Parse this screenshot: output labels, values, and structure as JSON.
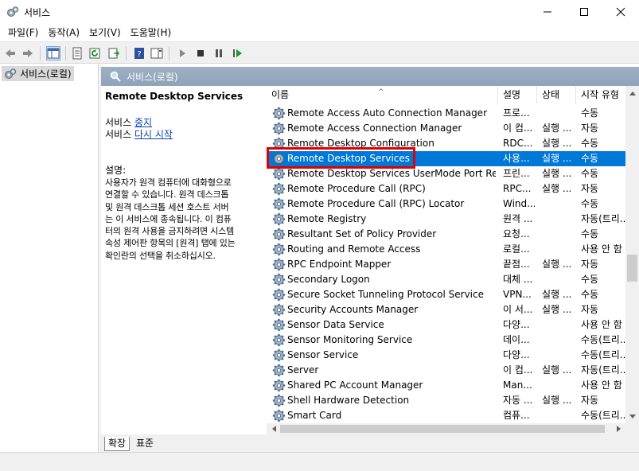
{
  "window": {
    "title": "서비스"
  },
  "menu": [
    "파일(F)",
    "동작(A)",
    "보기(V)",
    "도움말(H)"
  ],
  "tree": {
    "root_label": "서비스(로컬)"
  },
  "panel": {
    "header_label": "서비스(로컬)"
  },
  "detail": {
    "service_name": "Remote Desktop Services",
    "stop_prefix": "서비스 ",
    "stop_link": "중지",
    "restart_prefix": "서비스 ",
    "restart_link": "다시 시작",
    "desc_label": "설명:",
    "desc_lines": [
      "사용자가 원격 컴퓨터에 대화형으로",
      "연결할 수 있습니다. 원격 데스크톱",
      "및 원격 데스크톱 세션 호스트 서버",
      "는 이 서비스에 종속됩니다. 이 컴퓨",
      "터의 원격 사용을 금지하려면 시스템",
      "속성 제어판 항목의 [원격] 탭에 있는",
      "확인란의 선택을 취소하십시오."
    ]
  },
  "columns": {
    "name": "이름",
    "description": "설명",
    "status": "상태",
    "startup": "시작 유형"
  },
  "rows": [
    {
      "name": "Remote Access Auto Connection Manager",
      "desc": "프로...",
      "status": "",
      "startup": "수동"
    },
    {
      "name": "Remote Access Connection Manager",
      "desc": "이 컴...",
      "status": "실행 ...",
      "startup": "자동"
    },
    {
      "name": "Remote Desktop Configuration",
      "desc": "RDC...",
      "status": "실행 ...",
      "startup": "수동"
    },
    {
      "name": "Remote Desktop Services",
      "desc": "사용...",
      "status": "실행 ...",
      "startup": "수동"
    },
    {
      "name": "Remote Desktop Services UserMode Port Redir...",
      "desc": "프린...",
      "status": "실행 ...",
      "startup": "수동"
    },
    {
      "name": "Remote Procedure Call (RPC)",
      "desc": "RPC...",
      "status": "실행 ...",
      "startup": "자동"
    },
    {
      "name": "Remote Procedure Call (RPC) Locator",
      "desc": "Wind...",
      "status": "",
      "startup": "수동"
    },
    {
      "name": "Remote Registry",
      "desc": "원격 ...",
      "status": "",
      "startup": "자동(트리..."
    },
    {
      "name": "Resultant Set of Policy Provider",
      "desc": "요청...",
      "status": "",
      "startup": "수동"
    },
    {
      "name": "Routing and Remote Access",
      "desc": "로컬...",
      "status": "",
      "startup": "사용 안 함"
    },
    {
      "name": "RPC Endpoint Mapper",
      "desc": "끝점...",
      "status": "실행 ...",
      "startup": "자동"
    },
    {
      "name": "Secondary Logon",
      "desc": "대체 ...",
      "status": "",
      "startup": "수동"
    },
    {
      "name": "Secure Socket Tunneling Protocol Service",
      "desc": "VPN...",
      "status": "실행 ...",
      "startup": "수동"
    },
    {
      "name": "Security Accounts Manager",
      "desc": "이 서...",
      "status": "실행 ...",
      "startup": "자동"
    },
    {
      "name": "Sensor Data Service",
      "desc": "다양...",
      "status": "",
      "startup": "사용 안 함"
    },
    {
      "name": "Sensor Monitoring Service",
      "desc": "데이...",
      "status": "",
      "startup": "수동(트리..."
    },
    {
      "name": "Sensor Service",
      "desc": "다양...",
      "status": "",
      "startup": "수동(트리..."
    },
    {
      "name": "Server",
      "desc": "이 컴...",
      "status": "실행 ...",
      "startup": "자동(트리..."
    },
    {
      "name": "Shared PC Account Manager",
      "desc": "Man...",
      "status": "",
      "startup": "사용 안 함"
    },
    {
      "name": "Shell Hardware Detection",
      "desc": "자동 ...",
      "status": "실행 ...",
      "startup": "자동"
    },
    {
      "name": "Smart Card",
      "desc": "컴퓨...",
      "status": "",
      "startup": "수동(트리..."
    }
  ],
  "selected_index": 3,
  "tabs": [
    "확장",
    "표준"
  ],
  "colors": {
    "selection": "#0078d7",
    "highlight": "#e00000",
    "header": "#9fb0c4"
  }
}
